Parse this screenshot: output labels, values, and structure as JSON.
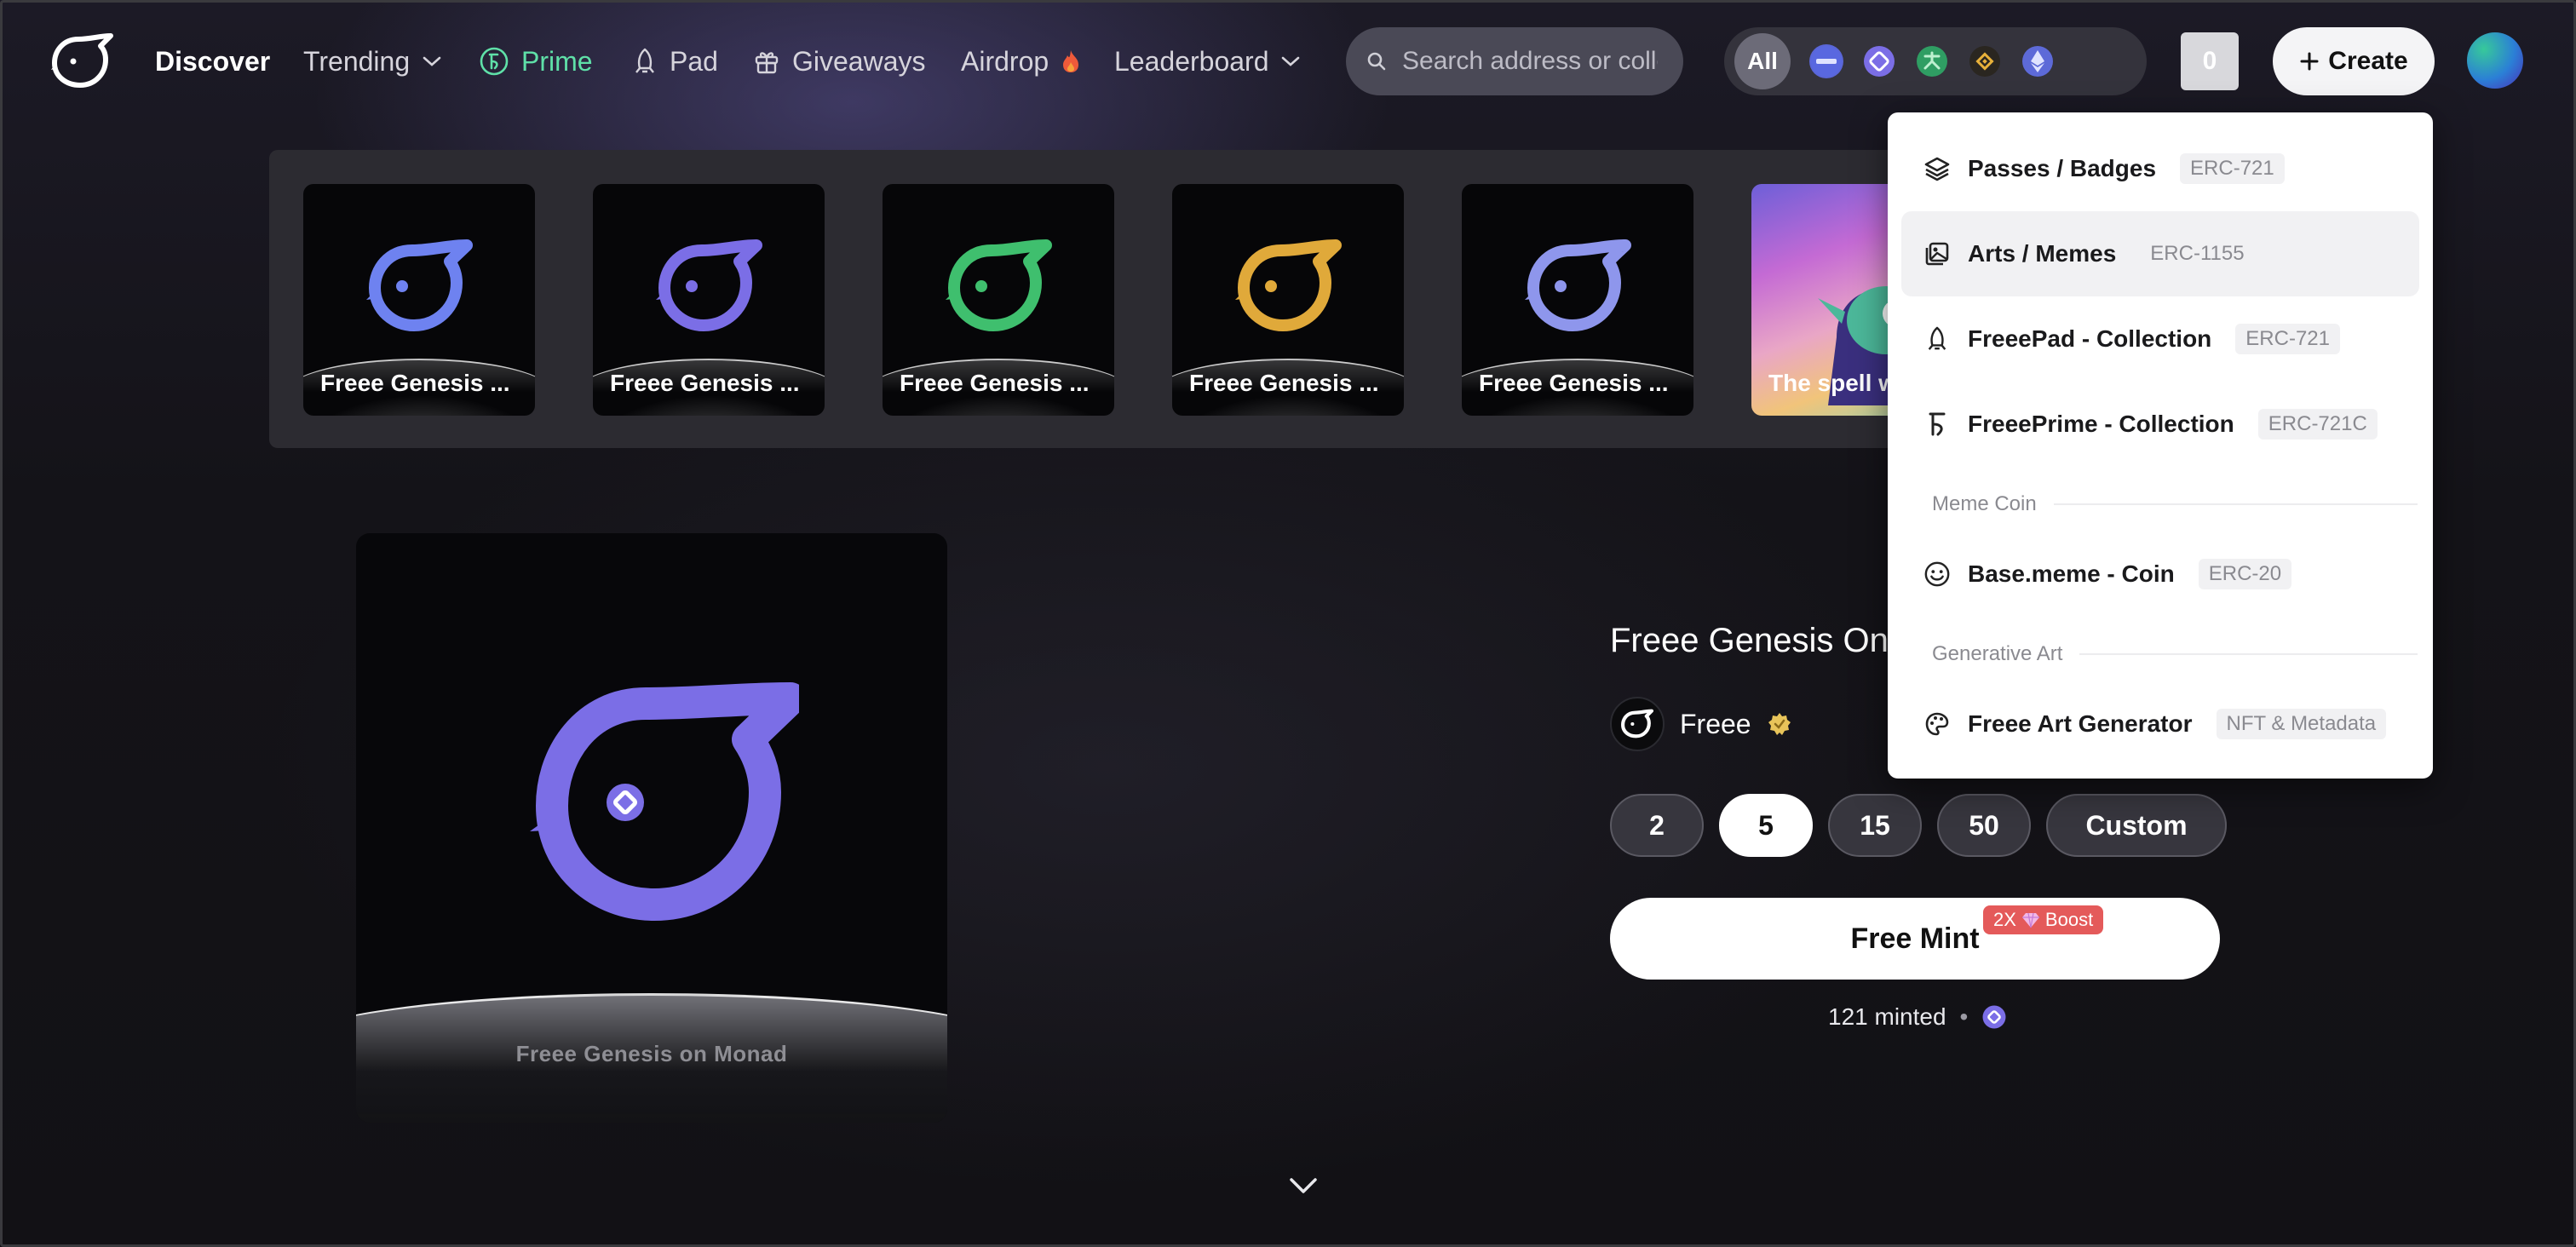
{
  "nav": {
    "logo_icon": "freee-bird-logo",
    "discover": "Discover",
    "trending": "Trending",
    "prime": "Prime",
    "pad": "Pad",
    "giveaways": "Giveaways",
    "airdrop": "Airdrop",
    "leaderboard": "Leaderboard",
    "search_placeholder": "Search address or collection",
    "chain_all": "All",
    "chain_icons": [
      "base-chain-icon",
      "monad-chain-icon",
      "abstract-chain-icon",
      "bnb-chain-icon",
      "ethereum-chain-icon"
    ],
    "count": "0",
    "create": "Create",
    "prime_color": "#5fe0a8"
  },
  "carousel": {
    "cards": [
      {
        "title": "Freee Genesis ...",
        "color": "#6e82f0"
      },
      {
        "title": "Freee Genesis ...",
        "color": "#7b6ee6"
      },
      {
        "title": "Freee Genesis ...",
        "color": "#3fbf6e"
      },
      {
        "title": "Freee Genesis ...",
        "color": "#e0a93a"
      },
      {
        "title": "Freee Genesis ...",
        "color": "#8e96ec"
      },
      {
        "title": "The spell w..."
      }
    ]
  },
  "hero": {
    "image_caption": "Freee Genesis on Monad",
    "title": "Freee Genesis On",
    "creator": "Freee",
    "quantities": [
      "2",
      "5",
      "15",
      "50",
      "Custom"
    ],
    "selected_quantity": "5",
    "mint_label": "Free Mint",
    "boost": "2X",
    "boost_label": "Boost",
    "minted": "121 minted",
    "accent": "#7b6ee6"
  },
  "create_menu": {
    "items": [
      {
        "label": "Passes / Badges",
        "tag": "ERC-721",
        "icon": "layers-icon"
      },
      {
        "label": "Arts / Memes",
        "tag": "ERC-1155",
        "icon": "gallery-icon"
      },
      {
        "label": "FreeePad - Collection",
        "tag": "ERC-721",
        "icon": "rocket-icon"
      },
      {
        "label": "FreeePrime - Collection",
        "tag": "ERC-721C",
        "icon": "prime-icon"
      }
    ],
    "meme_section": "Meme Coin",
    "meme_item": {
      "label": "Base.meme - Coin",
      "tag": "ERC-20",
      "icon": "smiley-icon"
    },
    "art_section": "Generative Art",
    "art_item": {
      "label": "Freee Art Generator",
      "tag": "NFT & Metadata",
      "icon": "palette-icon"
    }
  }
}
